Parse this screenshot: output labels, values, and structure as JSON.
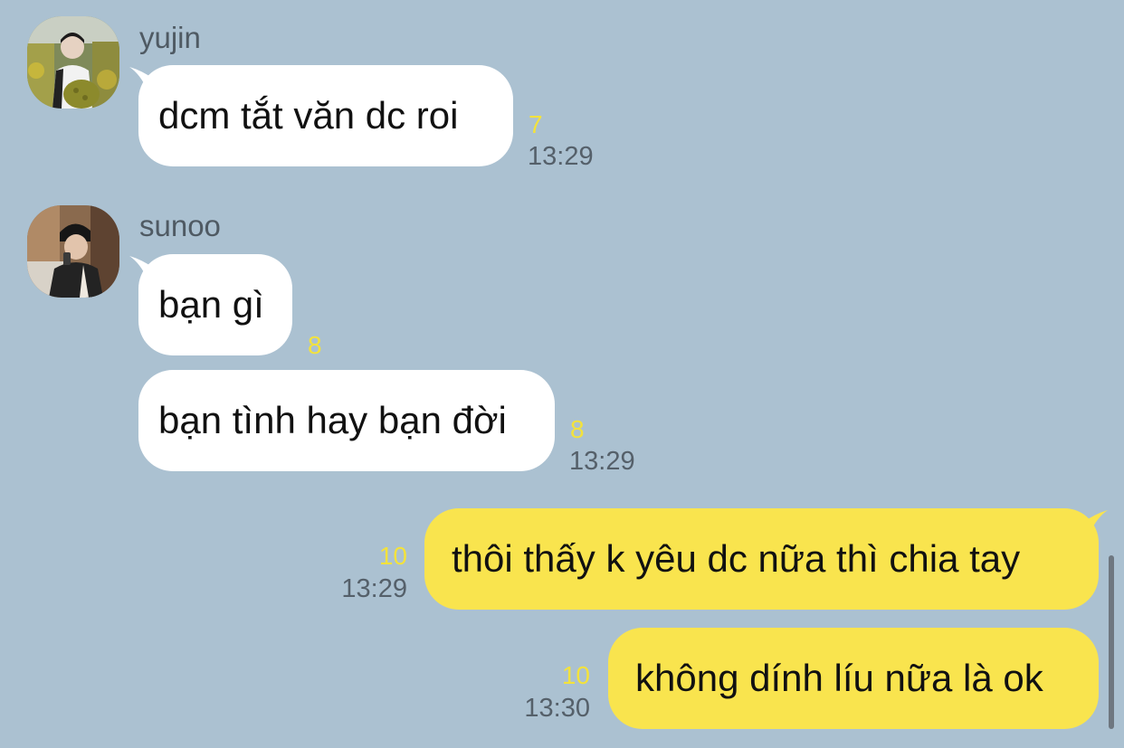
{
  "colors": {
    "background": "#abc1d1",
    "incoming_bubble": "#ffffff",
    "outgoing_bubble": "#f9e44e",
    "unread_count": "#f3e23c",
    "timestamp": "#55606a"
  },
  "messages": [
    {
      "sender": "yujin",
      "direction": "incoming",
      "avatar": "profile-photo",
      "bubbles": [
        {
          "text": "dcm tắt văn dc roi",
          "unread": "7",
          "time": "13:29"
        }
      ]
    },
    {
      "sender": "sunoo",
      "direction": "incoming",
      "avatar": "profile-photo",
      "bubbles": [
        {
          "text": "bạn gì",
          "unread": "8",
          "time": ""
        },
        {
          "text": "bạn tình hay bạn đời",
          "unread": "8",
          "time": "13:29"
        }
      ]
    },
    {
      "sender": "",
      "direction": "outgoing",
      "bubbles": [
        {
          "text": "thôi thấy k yêu dc nữa thì chia tay",
          "unread": "10",
          "time": "13:29"
        },
        {
          "text": "không dính líu nữa là ok",
          "unread": "10",
          "time": "13:30"
        }
      ]
    }
  ]
}
